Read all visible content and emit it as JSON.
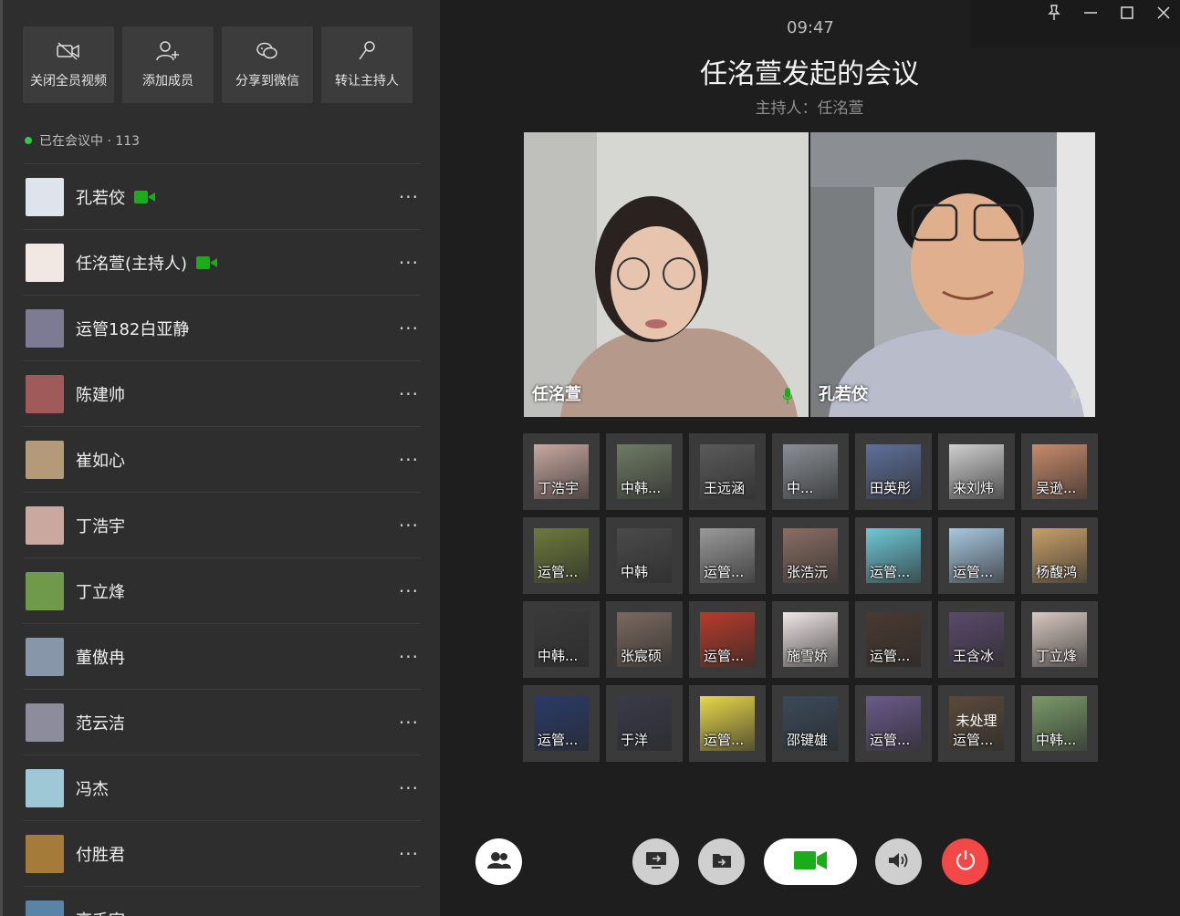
{
  "sidebar": {
    "actions": [
      {
        "label": "关闭全员视频",
        "icon": "video-off-icon"
      },
      {
        "label": "添加成员",
        "icon": "add-user-icon"
      },
      {
        "label": "分享到微信",
        "icon": "wechat-icon"
      },
      {
        "label": "转让主持人",
        "icon": "microphone-icon"
      }
    ],
    "status": "已在会议中 · 113",
    "members": [
      {
        "name": "孔若佼",
        "camera": true,
        "color": "#dfe3ec"
      },
      {
        "name": "任洺萱(主持人)",
        "camera": true,
        "color": "#f1e7e3"
      },
      {
        "name": "运管182白亚静",
        "camera": false,
        "color": "#7d7a93"
      },
      {
        "name": "陈建帅",
        "camera": false,
        "color": "#a15a5a"
      },
      {
        "name": "崔如心",
        "camera": false,
        "color": "#b49a78"
      },
      {
        "name": "丁浩宇",
        "camera": false,
        "color": "#c9a8a0"
      },
      {
        "name": "丁立烽",
        "camera": false,
        "color": "#6f9a4b"
      },
      {
        "name": "董傲冉",
        "camera": false,
        "color": "#8796a8"
      },
      {
        "name": "范云洁",
        "camera": false,
        "color": "#8c8c9c"
      },
      {
        "name": "冯杰",
        "camera": false,
        "color": "#9ec8d6"
      },
      {
        "name": "付胜君",
        "camera": false,
        "color": "#a57b3a"
      },
      {
        "name": "高千宇",
        "camera": false,
        "color": "#5a83a8"
      }
    ],
    "more_label": "···"
  },
  "meeting": {
    "time": "09:47",
    "title": "任洺萱发起的会议",
    "host": "主持人：任洺萱"
  },
  "videos": [
    {
      "name": "任洺萱",
      "mic": true
    },
    {
      "name": "孔若佼",
      "mic": true
    }
  ],
  "grid": [
    {
      "name": "丁浩宇",
      "color": "#c9a8a0"
    },
    {
      "name": "中韩...",
      "color": "#6f7b64"
    },
    {
      "name": "王远涵",
      "color": "#5a5a5a"
    },
    {
      "name": "中...",
      "color": "#8a8f95"
    },
    {
      "name": "田英彤",
      "color": "#5e6f9a"
    },
    {
      "name": "来刘炜",
      "color": "#cfcfcf"
    },
    {
      "name": "吴逊...",
      "color": "#c98a6a"
    },
    {
      "name": "运管...",
      "color": "#6d7a3a"
    },
    {
      "name": "中韩",
      "color": "#4a4a4a"
    },
    {
      "name": "运管...",
      "color": "#9a9a9a"
    },
    {
      "name": "张浩沅",
      "color": "#8a6e64"
    },
    {
      "name": "运管...",
      "color": "#6ec9d6"
    },
    {
      "name": "运管...",
      "color": "#a8c8e0"
    },
    {
      "name": "杨馥鸿",
      "color": "#c9a068"
    },
    {
      "name": "中韩...",
      "color": "#3a3a3a"
    },
    {
      "name": "张宸硕",
      "color": "#7a6a5e"
    },
    {
      "name": "运管...",
      "color": "#b83a2a"
    },
    {
      "name": "施雪娇",
      "color": "#f0e6e6"
    },
    {
      "name": "运管...",
      "color": "#4a3a30"
    },
    {
      "name": "王含冰",
      "color": "#5a4a6a"
    },
    {
      "name": "丁立烽",
      "color": "#d8c8c0"
    },
    {
      "name": "运管...",
      "color": "#2a3a6a"
    },
    {
      "name": "于洋",
      "color": "#3a3a4a"
    },
    {
      "name": "运管...",
      "color": "#e8d84a"
    },
    {
      "name": "邵键雄",
      "color": "#3a4a5a"
    },
    {
      "name": "运管...",
      "color": "#6a5a8a"
    },
    {
      "name": "运管...",
      "color": "#5a4a3a",
      "status": "未处理"
    },
    {
      "name": "中韩...",
      "color": "#7a9a6a"
    }
  ],
  "controls": {
    "members": "members-icon",
    "share_screen": "share-screen-icon",
    "share_file": "share-file-icon",
    "camera": "camera-icon",
    "speaker": "speaker-icon",
    "hangup": "power-icon",
    "accent": "#1aad19",
    "hangup_color": "#f24848"
  }
}
